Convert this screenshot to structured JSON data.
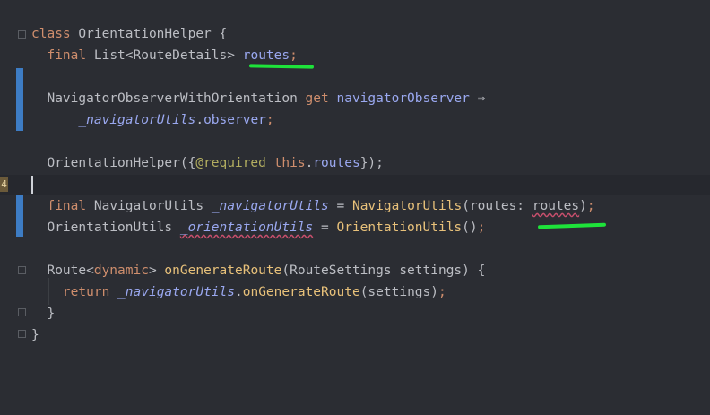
{
  "editor": {
    "lines": [
      {
        "id": "l1",
        "parts": [
          [
            "kw",
            "class"
          ],
          [
            "ty",
            " OrientationHelper {"
          ]
        ]
      },
      {
        "id": "l2",
        "parts": [
          [
            "ty",
            "  "
          ],
          [
            "kw",
            "final"
          ],
          [
            "ty",
            " List<RouteDetails> "
          ],
          [
            "fld",
            "routes"
          ],
          [
            "kw",
            ";"
          ]
        ]
      },
      {
        "id": "l3",
        "parts": [
          [
            "ty",
            ""
          ]
        ]
      },
      {
        "id": "l4",
        "parts": [
          [
            "ty",
            "  NavigatorObserverWithOrientation "
          ],
          [
            "kw",
            "get"
          ],
          [
            "ty",
            " "
          ],
          [
            "fld",
            "navigatorObserver"
          ],
          [
            "ty",
            " ⇒"
          ]
        ]
      },
      {
        "id": "l5",
        "parts": [
          [
            "ty",
            "      "
          ],
          [
            "priv",
            "_navigatorUtils"
          ],
          [
            "ty",
            "."
          ],
          [
            "fld",
            "observer"
          ],
          [
            "kw",
            ";"
          ]
        ]
      },
      {
        "id": "l6",
        "parts": [
          [
            "ty",
            ""
          ]
        ]
      },
      {
        "id": "l7",
        "parts": [
          [
            "ty",
            "  OrientationHelper({"
          ],
          [
            "ann",
            "@required"
          ],
          [
            "ty",
            " "
          ],
          [
            "kw",
            "this"
          ],
          [
            "ty",
            "."
          ],
          [
            "fld",
            "routes"
          ],
          [
            "ty",
            "});"
          ]
        ]
      },
      {
        "id": "l8",
        "parts": [
          [
            "ty",
            ""
          ]
        ]
      },
      {
        "id": "l9",
        "parts": [
          [
            "ty",
            "  "
          ],
          [
            "kw",
            "final"
          ],
          [
            "ty",
            " NavigatorUtils "
          ],
          [
            "priv",
            "_navigatorUtils"
          ],
          [
            "ty",
            " = "
          ],
          [
            "fn",
            "NavigatorUtils"
          ],
          [
            "ty",
            "(routes: "
          ],
          [
            "wavy",
            "routes"
          ],
          [
            "ty",
            ")"
          ],
          [
            "kw",
            ";"
          ]
        ]
      },
      {
        "id": "l10",
        "parts": [
          [
            "ty",
            "  OrientationUtils "
          ],
          [
            "privw",
            "_orientationUtils"
          ],
          [
            "ty",
            " = "
          ],
          [
            "fn",
            "OrientationUtils"
          ],
          [
            "ty",
            "()"
          ],
          [
            "kw",
            ";"
          ]
        ]
      },
      {
        "id": "l11",
        "parts": [
          [
            "ty",
            ""
          ]
        ]
      },
      {
        "id": "l12",
        "parts": [
          [
            "ty",
            "  Route<"
          ],
          [
            "kw",
            "dynamic"
          ],
          [
            "ty",
            "> "
          ],
          [
            "fn",
            "onGenerateRoute"
          ],
          [
            "ty",
            "(RouteSettings settings) {"
          ]
        ]
      },
      {
        "id": "l13",
        "parts": [
          [
            "ty",
            "    "
          ],
          [
            "kw",
            "return"
          ],
          [
            "ty",
            " "
          ],
          [
            "priv",
            "_navigatorUtils"
          ],
          [
            "ty",
            "."
          ],
          [
            "fn",
            "onGenerateRoute"
          ],
          [
            "ty",
            "(settings)"
          ],
          [
            "kw",
            ";"
          ]
        ]
      },
      {
        "id": "l14",
        "parts": [
          [
            "ty",
            "  }"
          ]
        ]
      },
      {
        "id": "l15",
        "parts": [
          [
            "ty",
            "}"
          ]
        ]
      }
    ],
    "gutter_badge": "4"
  }
}
